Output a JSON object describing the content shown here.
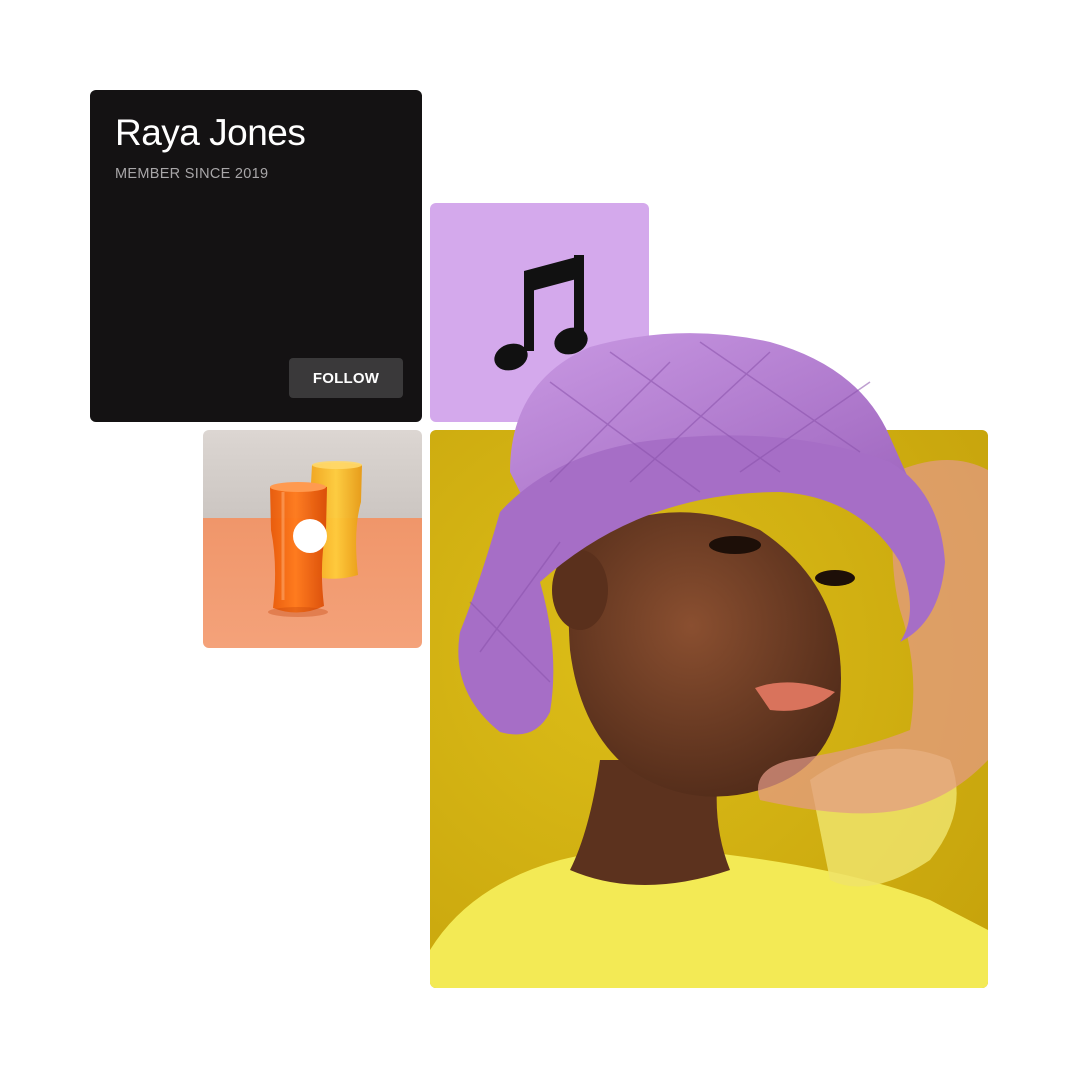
{
  "profile": {
    "name": "Raya Jones",
    "member_since": "MEMBER SINCE 2019",
    "follow_label": "FOLLOW"
  },
  "tiles": {
    "music": {
      "icon": "music-note-icon",
      "background": "#d4a9ec"
    },
    "glasses": {
      "image": "orange-glasses-photo",
      "marker_icon": "white-dot-icon"
    },
    "portrait": {
      "image": "portrait-photo"
    }
  },
  "colors": {
    "card_bg": "#141213",
    "button_bg": "#3a393a",
    "lavender": "#d4a9ec",
    "mustard": "#d4b412"
  }
}
